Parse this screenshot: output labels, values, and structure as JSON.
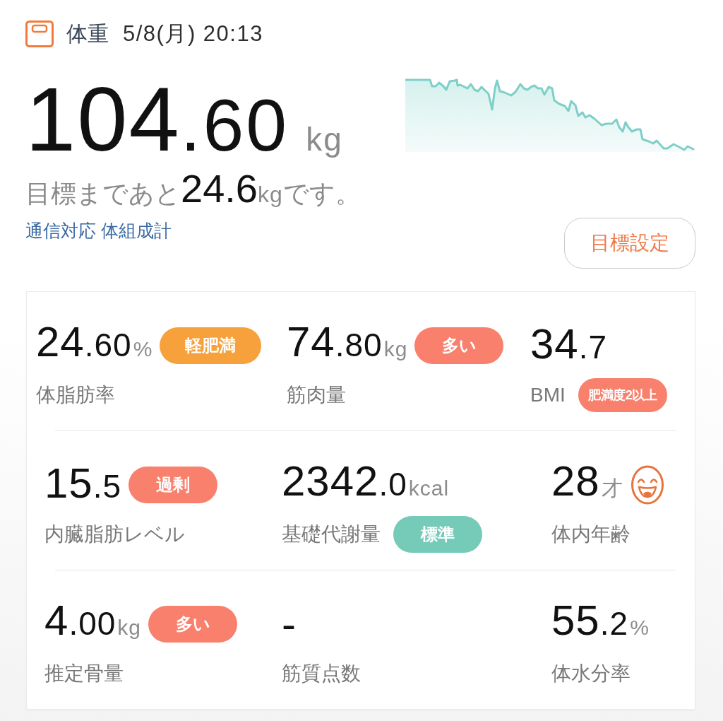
{
  "header": {
    "title": "体重",
    "datetime": "5/8(月) 20:13"
  },
  "weight": {
    "whole": "104",
    "fraction": ".60",
    "unit": "kg"
  },
  "goal_message": {
    "prefix": "目標まであと",
    "value": "24.6",
    "unit": "kg",
    "suffix": "です。"
  },
  "device_link": "通信対応 体組成計",
  "goal_button": "目標設定",
  "metric_rows": [
    {
      "metrics": [
        {
          "kind": "value_badge",
          "whole": "24",
          "fraction": ".60",
          "unit": "%",
          "label": "体脂肪率",
          "badge": {
            "text": "軽肥満",
            "color": "#f6a13c"
          }
        },
        {
          "kind": "value_badge",
          "whole": "74",
          "fraction": ".80",
          "unit": "kg",
          "label": "筋肉量",
          "badge": {
            "text": "多い",
            "color": "#f8806d"
          }
        },
        {
          "kind": "label_badge",
          "whole": "34",
          "fraction": ".7",
          "label": "BMI",
          "badge": {
            "text": "肥満度2以上",
            "color": "#f8806d"
          }
        }
      ]
    },
    {
      "metrics": [
        {
          "kind": "value_badge",
          "whole": "15",
          "fraction": ".5",
          "label": "内臓脂肪レベル",
          "badge": {
            "text": "過剰",
            "color": "#f8806d"
          }
        },
        {
          "kind": "label_badge",
          "whole": "2342",
          "fraction": ".0",
          "unit": "kcal",
          "label": "基礎代謝量",
          "badge": {
            "text": "標準",
            "color": "#75cab8"
          }
        },
        {
          "kind": "face",
          "whole": "28",
          "unit": "才",
          "label": "体内年齢"
        }
      ]
    },
    {
      "metrics": [
        {
          "kind": "value_badge",
          "whole": "4",
          "fraction": ".00",
          "unit": "kg",
          "label": "推定骨量",
          "badge": {
            "text": "多い",
            "color": "#f8806d"
          }
        },
        {
          "kind": "plain",
          "whole": "-",
          "label": "筋質点数"
        },
        {
          "kind": "plain",
          "whole": "55",
          "fraction": ".2",
          "unit": "%",
          "label": "体水分率"
        }
      ]
    }
  ]
}
